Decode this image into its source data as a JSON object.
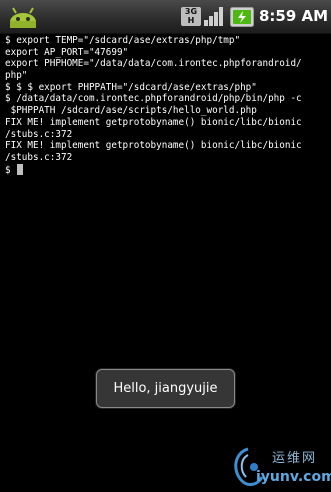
{
  "status_bar": {
    "network_type": "3G",
    "network_sub": "H",
    "time": "8:59 AM",
    "icons": [
      "android-icon",
      "3g-network-icon",
      "signal-strength-icon",
      "battery-charging-icon"
    ]
  },
  "terminal": {
    "lines": [
      "$ export TEMP=\"/sdcard/ase/extras/php/tmp\"",
      "export AP_PORT=\"47699\"",
      "export PHPHOME=\"/data/data/com.irontec.phpforandroid/",
      "php\"",
      "$ $ $ export PHPPATH=\"/sdcard/ase/extras/php\"",
      "$ /data/data/com.irontec.phpforandroid/php/bin/php -c",
      " $PHPPATH /sdcard/ase/scripts/hello_world.php",
      "FIX ME! implement getprotobyname() bionic/libc/bionic",
      "/stubs.c:372",
      "FIX ME! implement getprotobyname() bionic/libc/bionic",
      "/stubs.c:372"
    ],
    "prompt": "$ "
  },
  "toast": {
    "message": "Hello, jiangyujie"
  },
  "watermark": {
    "top_text": "运维网",
    "bottom_text": "iyunv.com"
  }
}
